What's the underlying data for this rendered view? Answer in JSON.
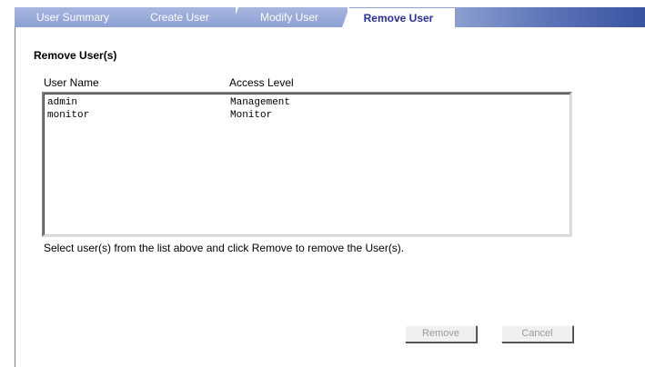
{
  "tabs": [
    {
      "label": "User Summary",
      "active": false
    },
    {
      "label": "Create User",
      "active": false
    },
    {
      "label": "Modify User",
      "active": false
    },
    {
      "label": "Remove User",
      "active": true
    }
  ],
  "section": {
    "title": "Remove User(s)"
  },
  "table": {
    "columns": [
      "User Name",
      "Access Level"
    ],
    "rows": [
      [
        "admin",
        "Management"
      ],
      [
        "monitor",
        "Monitor"
      ]
    ]
  },
  "hint": "Select user(s) from the list above and click Remove to remove the User(s).",
  "buttons": {
    "remove": "Remove",
    "cancel": "Cancel"
  },
  "colors": {
    "tab_active_text": "#2a2f9e",
    "tab_inactive_bg": "#8d9fd3",
    "tabbar_fill": "#5b73b8",
    "disabled_button_text": "#9a9a9a"
  }
}
